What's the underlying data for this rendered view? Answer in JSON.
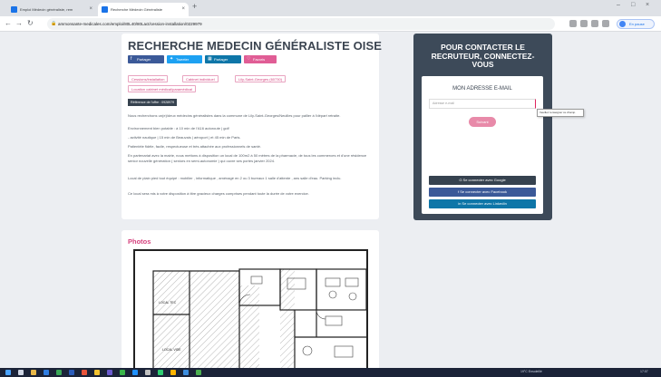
{
  "browser": {
    "tabs": [
      {
        "label": "Emploi Médecin généraliste, rem"
      },
      {
        "label": "Recherche Médecin Généraliste"
      }
    ],
    "url": "ammonsante-medicales.com/emploi/80L40/80Lact/cession-installation/0229979",
    "profile_label": "En pause"
  },
  "page": {
    "title": "RECHERCHE MEDECIN GÉNÉRALISTE OISE",
    "share_buttons": [
      {
        "label": "Partager",
        "color": "#3b5998"
      },
      {
        "label": "Tweeter",
        "color": "#1da1f2"
      },
      {
        "label": "Partager",
        "color": "#0e76a8"
      },
      {
        "label": "Favoris",
        "color": "#e05d95"
      }
    ],
    "tags": [
      "Cessions/installation",
      "Cabinet individuel",
      "Lily-Saint-Georges (60730)",
      "Location cabinet médical/paramédical"
    ],
    "reference": "Référence de l'offre : 0928979",
    "paragraphs": [
      "Nous recherchons un(e)/deux médecins généralistes dans la commune de Lily-Saint-Georges/Neuilles pour pallier à l'départ retraite.",
      "Environnement bien potable : à 10 min de l'A16 autoroute | golf",
      "- activité nautique | 15 min de Beauvais | aéroport | et 45 min de Paris.",
      "Patientèle fidèle, facile, respectueuse et très attachée aux professionnels de santé.",
      "En partenariat avec la mairie, nous mettons à disposition un local de 100m2 à 50 mètres de la pharmacie, de tous les commerces et d'une résidence senior nouvelle génération ( seniors en semi-autonomie ) qui ouvre ses portes janvier 2024.",
      "Local de plain pied tout équipé : mobilier , informatique , aménagé en 2 ou 3 bureaux 1 salle d'attente , ans salle d'eau. Parking inclu.",
      "Ce local sera mis à votre disposition à titre gracieux charges comprises pendant toute la durée de votre exercice."
    ],
    "photos_title": "Photos"
  },
  "sidebar": {
    "title_lines": [
      "POUR CONTACTER LE",
      "RECRUTEUR, CONNECTEZ-",
      "VOUS"
    ],
    "email_heading": "MON ADRESSE E-MAIL",
    "email_placeholder": "Adresse e-mail",
    "tooltip": "Veuillez renseigner ce champ.",
    "submit_label": "Suivant",
    "social_buttons": [
      {
        "label": "Se connecter avec Google",
        "color": "#36424f"
      },
      {
        "label": "Se connecter avec Facebook",
        "color": "#3b5998"
      },
      {
        "label": "Se connecter avec LinkedIn",
        "color": "#0e76a8"
      }
    ]
  },
  "taskbar": {
    "weather": "19°C Ensoleillé",
    "time": "17:07"
  }
}
